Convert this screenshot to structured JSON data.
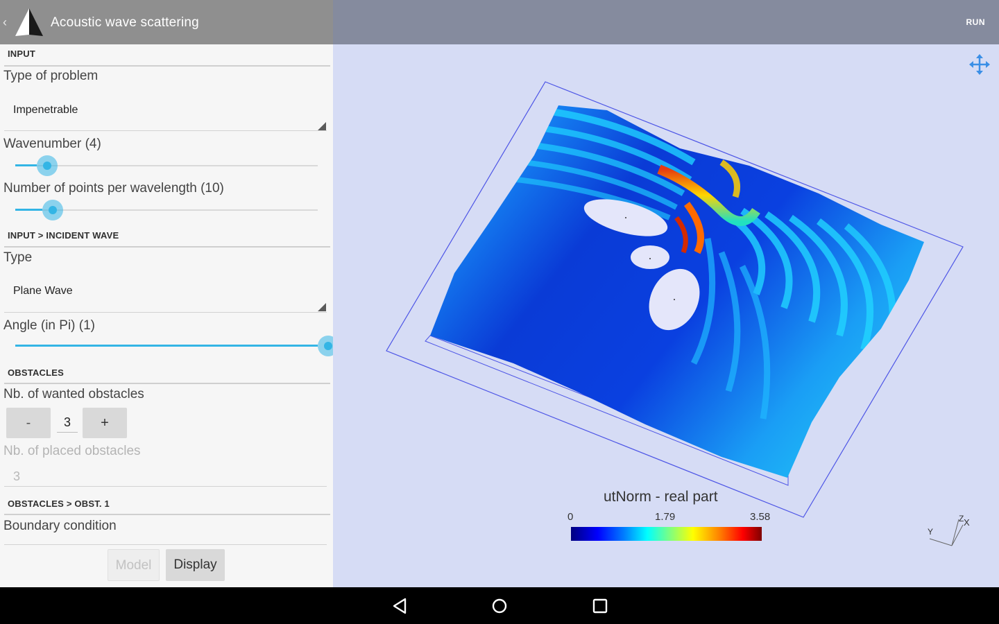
{
  "app": {
    "title": "Acoustic wave scattering",
    "run_label": "RUN"
  },
  "sections": {
    "input": "INPUT",
    "incident_wave": "INPUT > INCIDENT WAVE",
    "obstacles": "OBSTACLES",
    "obstacle_1": "OBSTACLES > OBST. 1"
  },
  "fields": {
    "problem_type_label": "Type of problem",
    "problem_type_value": "Impenetrable",
    "wavenumber_label": "Wavenumber (4)",
    "wavenumber_fraction": 0.07,
    "points_label": "Number of points per wavelength (10)",
    "points_fraction": 0.09,
    "wave_type_label": "Type",
    "wave_type_value": "Plane Wave",
    "angle_label": "Angle (in Pi) (1)",
    "angle_fraction": 1.0,
    "wanted_obstacles_label": "Nb. of wanted obstacles",
    "minus_label": "-",
    "wanted_obstacles_value": "3",
    "plus_label": "+",
    "placed_obstacles_label": "Nb. of placed obstacles",
    "placed_obstacles_value": "3",
    "boundary_label": "Boundary condition"
  },
  "buttons": {
    "model": "Model",
    "display": "Display"
  },
  "plot": {
    "colorbar_title": "utNorm - real part",
    "tick_min": "0",
    "tick_mid": "1.79",
    "tick_max": "3.58",
    "axis_y": "Y",
    "axis_z": "Z",
    "axis_x": "X"
  },
  "colors": {
    "accent": "#33b5e5",
    "viewport_bg": "#d6dcf5",
    "appbar_left": "#8f8f8f",
    "appbar_right": "#858b9e"
  }
}
